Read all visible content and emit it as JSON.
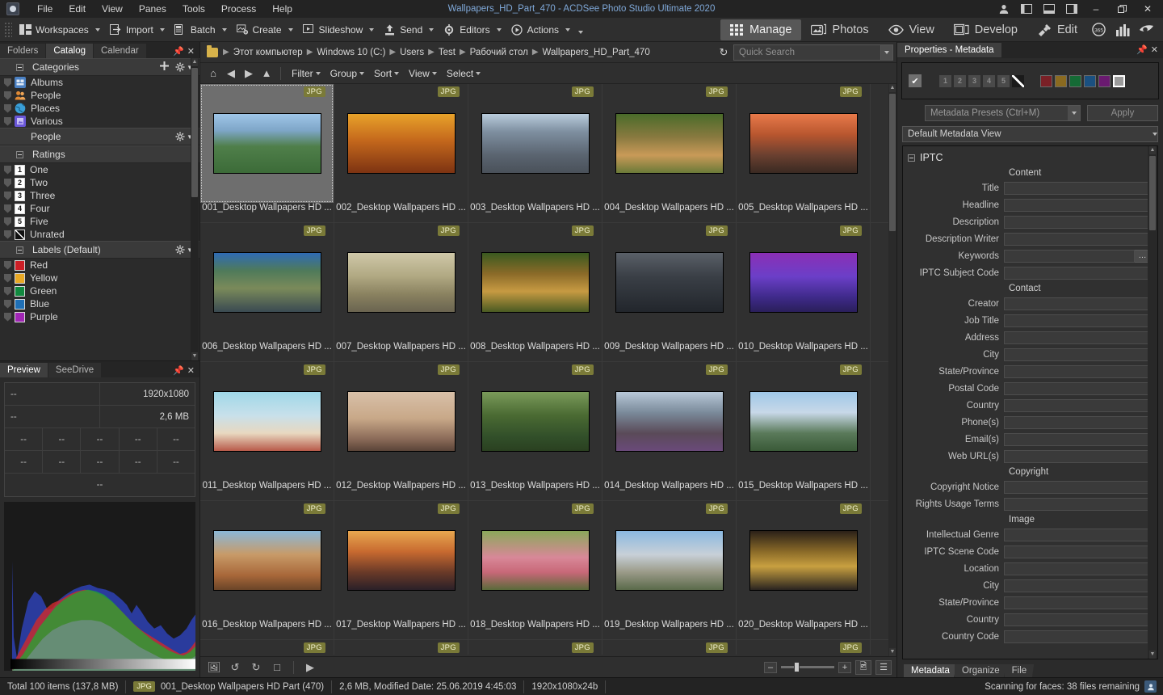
{
  "titlebar": {
    "app_icon": "acdsee-logo-icon",
    "title": "Wallpapers_HD_Part_470 - ACDSee Photo Studio Ultimate 2020",
    "menus": [
      "File",
      "Edit",
      "View",
      "Panes",
      "Tools",
      "Process",
      "Help"
    ],
    "right_icons": [
      "account-icon",
      "layout-left-icon",
      "layout-bottom-icon",
      "layout-right-icon"
    ],
    "window_controls": {
      "minimize": "–",
      "maximize": "❐",
      "close": "✕"
    }
  },
  "toolbar": {
    "buttons": [
      {
        "label": "Workspaces",
        "icon": "workspaces-icon",
        "caret": true
      },
      {
        "label": "Import",
        "icon": "import-icon",
        "caret": true
      },
      {
        "label": "Batch",
        "icon": "batch-icon",
        "caret": true
      },
      {
        "label": "Create",
        "icon": "create-icon",
        "caret": true
      },
      {
        "label": "Slideshow",
        "icon": "slideshow-icon",
        "caret": true
      },
      {
        "label": "Send",
        "icon": "send-icon",
        "caret": true
      },
      {
        "label": "Editors",
        "icon": "editors-icon",
        "caret": true
      },
      {
        "label": "Actions",
        "icon": "actions-icon",
        "caret": true
      }
    ],
    "modes": [
      {
        "label": "Manage",
        "icon": "grid-icon",
        "active": true
      },
      {
        "label": "Photos",
        "icon": "photos-icon",
        "active": false
      },
      {
        "label": "View",
        "icon": "eye-icon",
        "active": false
      },
      {
        "label": "Develop",
        "icon": "develop-icon",
        "active": false
      },
      {
        "label": "Edit",
        "icon": "edit-brush-icon",
        "active": false
      }
    ],
    "mode_icons": [
      "365-icon",
      "chart-icon",
      "eye-dial-icon"
    ]
  },
  "left_panel": {
    "tabs": [
      {
        "label": "Folders",
        "active": false
      },
      {
        "label": "Catalog",
        "active": true
      },
      {
        "label": "Calendar",
        "active": false
      }
    ],
    "pin": "pin-icon",
    "close": "close-icon",
    "sections": [
      {
        "title": "Categories",
        "collapsible": true,
        "actions": [
          "plus-icon",
          "gear-icon"
        ],
        "items": [
          {
            "label": "Albums",
            "color": "#4a7fc1"
          },
          {
            "label": "People",
            "color": "#e08a35"
          },
          {
            "label": "Places",
            "color": "#3a9fd8"
          },
          {
            "label": "Various",
            "color": "#6a57d8"
          }
        ]
      },
      {
        "title": "People",
        "collapsible": false,
        "actions": [
          "gear-icon"
        ],
        "items": []
      },
      {
        "title": "Ratings",
        "collapsible": true,
        "actions": [],
        "items": [
          {
            "label": "One",
            "badge": "1"
          },
          {
            "label": "Two",
            "badge": "2"
          },
          {
            "label": "Three",
            "badge": "3"
          },
          {
            "label": "Four",
            "badge": "4"
          },
          {
            "label": "Five",
            "badge": "5"
          },
          {
            "label": "Unrated",
            "badge": "/"
          }
        ]
      },
      {
        "title": "Labels (Default)",
        "collapsible": true,
        "actions": [
          "gear-icon"
        ],
        "items": [
          {
            "label": "Red",
            "color": "#cc1f26"
          },
          {
            "label": "Yellow",
            "color": "#e8a825"
          },
          {
            "label": "Green",
            "color": "#11893f"
          },
          {
            "label": "Blue",
            "color": "#1f6fb5"
          },
          {
            "label": "Purple",
            "color": "#a026b5"
          }
        ]
      }
    ]
  },
  "preview_panel": {
    "tabs": [
      {
        "label": "Preview",
        "active": true
      },
      {
        "label": "SeeDrive",
        "active": false
      }
    ],
    "pin": "pin-icon",
    "close": "close-icon",
    "info_rows": [
      [
        "--",
        "1920x1080"
      ],
      [
        "--",
        "2,6 MB"
      ],
      [
        "--",
        "--",
        "--",
        "--",
        "--"
      ],
      [
        "--",
        "--",
        "--",
        "--",
        "--"
      ],
      [
        "--"
      ]
    ],
    "histogram": "rgb-histogram"
  },
  "path_bar": {
    "folder_icon": "folder-icon",
    "crumbs": [
      "Этот компьютер",
      "Windows 10 (C:)",
      "Users",
      "Test",
      "Рабочий стол",
      "Wallpapers_HD_Part_470"
    ],
    "refresh_icon": "refresh-icon",
    "search_placeholder": "Quick Search"
  },
  "filter_bar": {
    "nav_icons": [
      "home-icon",
      "back-icon",
      "forward-icon",
      "up-icon"
    ],
    "menus": [
      "Filter",
      "Group",
      "Sort",
      "View",
      "Select"
    ]
  },
  "thumbnails": {
    "badge": "JPG",
    "items": [
      {
        "name": "001_Desktop Wallpapers  HD ...",
        "selected": true,
        "grad": "linear-gradient(#9fc6e8 0%, #7ea6c8 28%, #4f7f4a 55%, #3c6b38 100%)"
      },
      {
        "name": "002_Desktop Wallpapers  HD ...",
        "selected": false,
        "grad": "linear-gradient(#e8a22a 0%, #c4681c 45%, #7d3312 100%)"
      },
      {
        "name": "003_Desktop Wallpapers  HD ...",
        "selected": false,
        "grad": "linear-gradient(#b9ccdc 0%, #7e8fa0 30%, #5a6470 70%, #4a515a 100%)"
      },
      {
        "name": "004_Desktop Wallpapers  HD ...",
        "selected": false,
        "grad": "linear-gradient(#4a6b2a 0%, #8a7a40 40%, #c99a58 70%, #6b7a38 100%)"
      },
      {
        "name": "005_Desktop Wallpapers  HD ...",
        "selected": false,
        "grad": "linear-gradient(#e87a4a 0%, #b8562f 35%, #6a4030 70%, #3a2a22 100%)"
      },
      {
        "name": "006_Desktop Wallpapers  HD ...",
        "selected": false,
        "grad": "linear-gradient(#2f6bb5 0%, #4f7a5a 30%, #7a8a5a 60%, #3a4a52 100%)"
      },
      {
        "name": "007_Desktop Wallpapers  HD ...",
        "selected": false,
        "grad": "linear-gradient(#cfc8a8 0%, #b0a882 40%, #8a8260 70%, #6a6450 100%)"
      },
      {
        "name": "008_Desktop Wallpapers  HD ...",
        "selected": false,
        "grad": "linear-gradient(#3a5a20 0%, #8a6a28 35%, #c79a42 65%, #4a5a22 100%)"
      },
      {
        "name": "009_Desktop Wallpapers  HD ...",
        "selected": false,
        "grad": "linear-gradient(#5a6068 0%, #3a3f46 40%, #22262c 100%)"
      },
      {
        "name": "010_Desktop Wallpapers  HD ...",
        "selected": false,
        "grad": "linear-gradient(#8b2fb5 0%, #6b3fc8 40%, #3f2a8a 75%, #2a1f5a 100%)"
      },
      {
        "name": "011_Desktop Wallpapers  HD ...",
        "selected": false,
        "grad": "linear-gradient(#9fd8e8 0%, #c8e0ea 40%, #e8d8c0 70%, #b85a4a 100%)"
      },
      {
        "name": "012_Desktop Wallpapers  HD ...",
        "selected": false,
        "grad": "linear-gradient(#d8c0a8 0%, #c8a888 45%, #8a6a58 80%, #5a4438 100%)"
      },
      {
        "name": "013_Desktop Wallpapers  HD ...",
        "selected": false,
        "grad": "linear-gradient(#7a9a5a 0%, #4a6a32 40%, #32502a 75%, #2a4020 100%)"
      },
      {
        "name": "014_Desktop Wallpapers  HD ...",
        "selected": false,
        "grad": "linear-gradient(#b8c8d8 0%, #7a8a9a 35%, #5a4a58 70%, #6a4a7a 100%)"
      },
      {
        "name": "015_Desktop Wallpapers  HD ...",
        "selected": false,
        "grad": "linear-gradient(#9fc8e8 0%, #c8d8e8 35%, #5a7a5a 70%, #3a5a38 100%)"
      },
      {
        "name": "016_Desktop Wallpapers  HD ...",
        "selected": false,
        "grad": "linear-gradient(#8ab8d8 0%, #c89a68 40%, #a8683a 75%, #6a4428 100%)"
      },
      {
        "name": "017_Desktop Wallpapers  HD ...",
        "selected": false,
        "grad": "linear-gradient(#e8a850 0%, #c86a30 35%, #6a3a28 70%, #2a2028 100%)"
      },
      {
        "name": "018_Desktop Wallpapers  HD ...",
        "selected": false,
        "grad": "linear-gradient(#8aa85a 0%, #d88898 45%, #c86878 70%, #5a6a3a 100%)"
      },
      {
        "name": "019_Desktop Wallpapers  HD ...",
        "selected": false,
        "grad": "linear-gradient(#8ab8e0 0%, #c8d0d8 40%, #9a9a88 70%, #5a6a4a 100%)"
      },
      {
        "name": "020_Desktop Wallpapers  HD ...",
        "selected": false,
        "grad": "linear-gradient(#2a2018 0%, #8a6a28 35%, #c8a040 60%, #2a2420 100%)"
      }
    ]
  },
  "bottom_toolbar": {
    "icons": [
      "rotate-image-icon",
      "rotate-left-icon",
      "rotate-right-icon",
      "stop-icon",
      "play-icon"
    ],
    "zoom": {
      "minus": "–",
      "plus": "+"
    },
    "view_buttons": [
      "thumbnail-view-icon",
      "list-view-icon"
    ]
  },
  "right_panel": {
    "title": "Properties - Metadata",
    "pin": "pin-icon",
    "close": "close-icon",
    "rating_bar": {
      "check": "✔",
      "ratings": [
        "1",
        "2",
        "3",
        "4",
        "5"
      ],
      "unrated": "slash-icon",
      "label_colors": [
        "#7a2026",
        "#8a6a20",
        "#156a35",
        "#1a5080",
        "#6a1a70",
        "#9a9a9a"
      ]
    },
    "presets": {
      "combo": "Metadata Presets (Ctrl+M)",
      "apply": "Apply"
    },
    "view_selector": "Default Metadata View",
    "group": {
      "title": "IPTC",
      "expanded": true
    },
    "sections": [
      {
        "heading": "Content",
        "fields": [
          {
            "label": "Title",
            "value": "",
            "has_dots": false
          },
          {
            "label": "Headline",
            "value": "",
            "has_dots": false
          },
          {
            "label": "Description",
            "value": "",
            "has_dots": false
          },
          {
            "label": "Description Writer",
            "value": "",
            "has_dots": false
          },
          {
            "label": "Keywords",
            "value": "",
            "has_dots": true
          },
          {
            "label": "IPTC Subject Code",
            "value": "",
            "has_dots": false
          }
        ]
      },
      {
        "heading": "Contact",
        "fields": [
          {
            "label": "Creator",
            "value": "",
            "has_dots": false
          },
          {
            "label": "Job Title",
            "value": "",
            "has_dots": false
          },
          {
            "label": "Address",
            "value": "",
            "has_dots": false
          },
          {
            "label": "City",
            "value": "",
            "has_dots": false
          },
          {
            "label": "State/Province",
            "value": "",
            "has_dots": false
          },
          {
            "label": "Postal Code",
            "value": "",
            "has_dots": false
          },
          {
            "label": "Country",
            "value": "",
            "has_dots": false
          },
          {
            "label": "Phone(s)",
            "value": "",
            "has_dots": false
          },
          {
            "label": "Email(s)",
            "value": "",
            "has_dots": false
          },
          {
            "label": "Web URL(s)",
            "value": "",
            "has_dots": false
          }
        ]
      },
      {
        "heading": "Copyright",
        "fields": [
          {
            "label": "Copyright Notice",
            "value": "",
            "has_dots": false
          },
          {
            "label": "Rights Usage Terms",
            "value": "",
            "has_dots": false
          }
        ]
      },
      {
        "heading": "Image",
        "fields": [
          {
            "label": "Intellectual Genre",
            "value": "",
            "has_dots": false
          },
          {
            "label": "IPTC Scene Code",
            "value": "",
            "has_dots": false
          },
          {
            "label": "Location",
            "value": "",
            "has_dots": false
          },
          {
            "label": "City",
            "value": "",
            "has_dots": false
          },
          {
            "label": "State/Province",
            "value": "",
            "has_dots": false
          },
          {
            "label": "Country",
            "value": "",
            "has_dots": false
          },
          {
            "label": "Country Code",
            "value": "",
            "has_dots": false
          }
        ]
      }
    ],
    "tabs": [
      {
        "label": "Metadata",
        "active": true
      },
      {
        "label": "Organize",
        "active": false
      },
      {
        "label": "File",
        "active": false
      }
    ]
  },
  "status_bar": {
    "total": "Total 100 items  (137,8 MB)",
    "file_badge": "JPG",
    "file_name": "001_Desktop Wallpapers  HD Part (470)",
    "file_info": "2,6 MB, Modified Date: 25.06.2019 4:45:03",
    "dimensions": "1920x1080x24b",
    "task": "Scanning for faces: 38 files remaining",
    "task_icon": "face-scan-icon"
  }
}
